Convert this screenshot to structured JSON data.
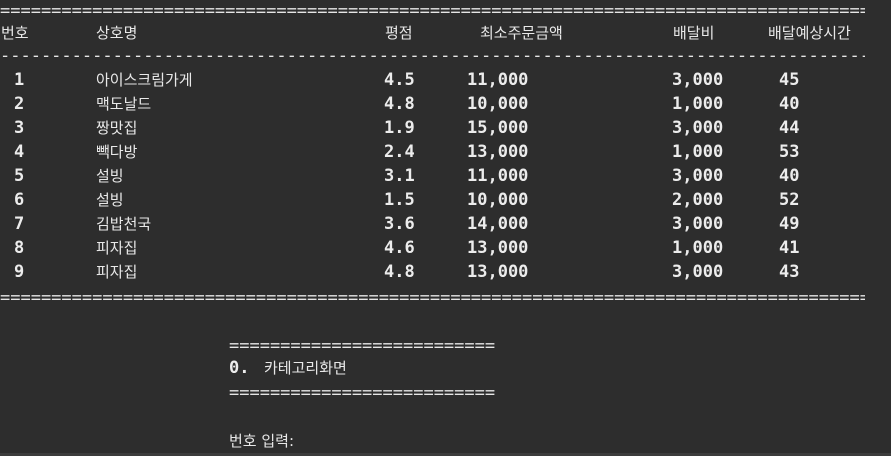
{
  "separators": {
    "double": "=======================================================================================",
    "single": "---------------------------------------------------------------------------------------",
    "menu": "=========================="
  },
  "headers": {
    "no": "번호",
    "name": "상호명",
    "rating": "평점",
    "min_order": "최소주문금액",
    "delivery_fee": "배달비",
    "eta": "배달예상시간"
  },
  "rows": [
    {
      "no": "1",
      "name": "아이스크림가게",
      "rating": "4.5",
      "min_order": "11,000",
      "delivery_fee": "3,000",
      "eta": "45"
    },
    {
      "no": "2",
      "name": "맥도날드",
      "rating": "4.8",
      "min_order": "10,000",
      "delivery_fee": "1,000",
      "eta": "40"
    },
    {
      "no": "3",
      "name": "짱맛집",
      "rating": "1.9",
      "min_order": "15,000",
      "delivery_fee": "3,000",
      "eta": "44"
    },
    {
      "no": "4",
      "name": "빽다방",
      "rating": "2.4",
      "min_order": "13,000",
      "delivery_fee": "1,000",
      "eta": "53"
    },
    {
      "no": "5",
      "name": "설빙",
      "rating": "3.1",
      "min_order": "11,000",
      "delivery_fee": "3,000",
      "eta": "40"
    },
    {
      "no": "6",
      "name": "설빙",
      "rating": "1.5",
      "min_order": "10,000",
      "delivery_fee": "2,000",
      "eta": "52"
    },
    {
      "no": "7",
      "name": "김밥천국",
      "rating": "3.6",
      "min_order": "14,000",
      "delivery_fee": "3,000",
      "eta": "49"
    },
    {
      "no": "8",
      "name": "피자집",
      "rating": "4.6",
      "min_order": "13,000",
      "delivery_fee": "1,000",
      "eta": "41"
    },
    {
      "no": "9",
      "name": "피자집",
      "rating": "4.8",
      "min_order": "13,000",
      "delivery_fee": "3,000",
      "eta": "43"
    }
  ],
  "menu": {
    "option_number": "0.",
    "option_label": "카테고리화면",
    "prompt": "번호 입력:"
  },
  "colors": {
    "background": "#2d2d2d",
    "text": "#e8e8e8"
  }
}
